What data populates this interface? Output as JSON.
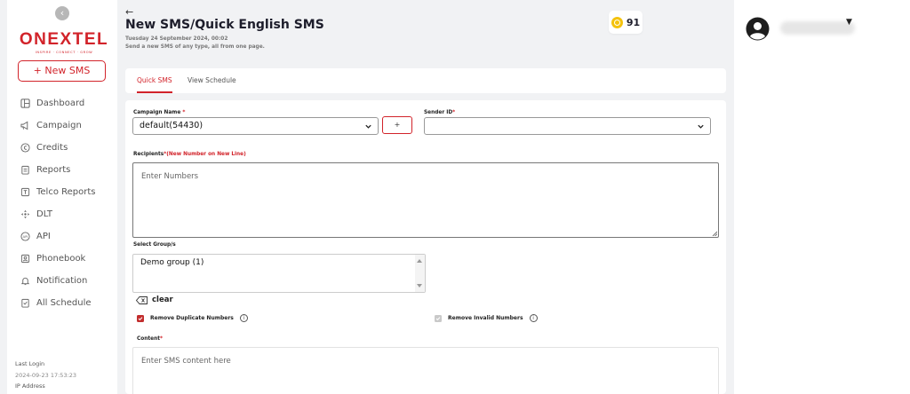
{
  "sidebar": {
    "collapse_icon": "chevron-left-icon",
    "logo": {
      "text": "ONEXTEL",
      "tagline": "INSPIRE · CONNECT · GROW"
    },
    "new_sms_label": "+ New SMS",
    "items": [
      {
        "label": "Dashboard",
        "icon": "dashboard-icon"
      },
      {
        "label": "Campaign",
        "icon": "megaphone-icon"
      },
      {
        "label": "Credits",
        "icon": "credits-icon"
      },
      {
        "label": "Reports",
        "icon": "report-icon"
      },
      {
        "label": "Telco Reports",
        "icon": "telco-report-icon"
      },
      {
        "label": "DLT",
        "icon": "dlt-icon"
      },
      {
        "label": "API",
        "icon": "api-icon"
      },
      {
        "label": "Phonebook",
        "icon": "phonebook-icon"
      },
      {
        "label": "Notification",
        "icon": "bell-icon"
      },
      {
        "label": "All Schedule",
        "icon": "schedule-icon"
      }
    ],
    "last_login_label": "Last Login",
    "last_login_value": "2024-09-23 17:53:23",
    "ip_label": "IP Address"
  },
  "header": {
    "title": "New SMS/Quick English SMS",
    "date": "Tuesday 24 September 2024, 00:02",
    "description": "Send a new SMS of any type, all from one page.",
    "credits": "91"
  },
  "tabs": [
    {
      "label": "Quick SMS",
      "active": true
    },
    {
      "label": "View Schedule",
      "active": false
    }
  ],
  "form": {
    "campaign_label": "Campaign Name ",
    "campaign_value": "default(54430)",
    "add_label": "+",
    "sender_label": "Sender ID",
    "sender_value": "",
    "required_mark": "*",
    "recipients_label": "Recipients",
    "recipients_hint": "*(New Number on New Line)",
    "recipients_placeholder": "Enter Numbers",
    "groups_label": "Select Group/s",
    "groups_options": [
      "Demo group (1)"
    ],
    "clear_label": "clear",
    "remove_duplicates_label": "Remove Duplicate Numbers",
    "remove_duplicates_checked": true,
    "remove_invalid_label": "Remove Invalid Numbers",
    "remove_invalid_checked": true,
    "content_label": "Content",
    "content_placeholder": "Enter SMS content here"
  },
  "colors": {
    "accent": "#d2232a",
    "coin": "#f4c20d"
  }
}
